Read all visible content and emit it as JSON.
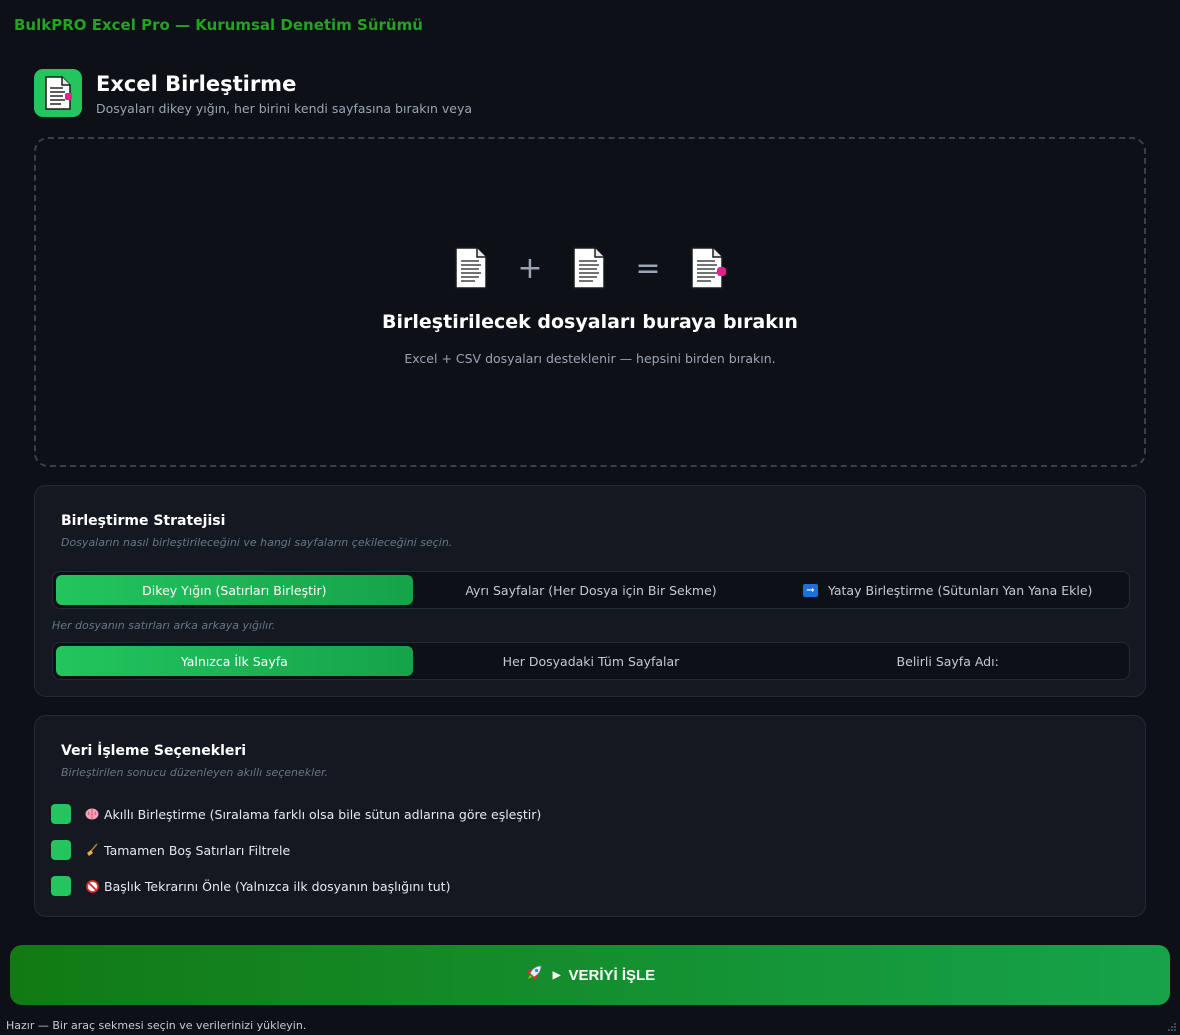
{
  "app": {
    "title": "BulkPRO Excel Pro — Kurumsal Denetim Sürümü"
  },
  "header": {
    "icon": "spreadsheet-merge-icon",
    "title": "Excel Birleştirme",
    "subtitle": "Dosyaları dikey yığın, her birini kendi sayfasına bırakın veya"
  },
  "dropzone": {
    "op_plus": "+",
    "op_equals": "=",
    "title": "Birleştirilecek dosyaları buraya bırakın",
    "subtitle": "Excel + CSV dosyaları desteklenir — hepsini birden bırakın."
  },
  "strategy": {
    "title": "Birleştirme Stratejisi",
    "subtitle": "Dosyaların nasıl birleştirileceğini ve hangi sayfaların çekileceğini seçin.",
    "modes": [
      {
        "label": "Dikey Yığın (Satırları Birleştir)",
        "active": true
      },
      {
        "label": "Ayrı Sayfalar (Her Dosya için Bir Sekme)",
        "active": false
      },
      {
        "label": "Yatay Birleştirme (Sütunları Yan Yana Ekle)",
        "active": false,
        "icon": "right-arrow-icon"
      }
    ],
    "mode_hint": "Her dosyanın satırları arka arkaya yığılır.",
    "sheets": [
      {
        "label": "Yalnızca İlk Sayfa",
        "active": true
      },
      {
        "label": "Her Dosyadaki Tüm Sayfalar",
        "active": false
      },
      {
        "label": "Belirli Sayfa Adı:",
        "active": false
      }
    ]
  },
  "processing": {
    "title": "Veri İşleme Seçenekleri",
    "subtitle": "Birleştirilen sonucu düzenleyen akıllı seçenekler.",
    "options": [
      {
        "label": "Akıllı Birleştirme (Sıralama farklı olsa bile sütun adlarına göre eşleştir)",
        "icon": "brain-icon",
        "checked": true
      },
      {
        "label": "Tamamen Boş Satırları Filtrele",
        "icon": "broom-icon",
        "checked": true
      },
      {
        "label": "Başlık Tekrarını Önle (Yalnızca ilk dosyanın başlığını tut)",
        "icon": "no-entry-icon",
        "checked": true
      }
    ]
  },
  "process_button": {
    "label": "VERİYİ İŞLE",
    "icon": "rocket-icon"
  },
  "status": {
    "text": "Hazır — Bir araç sekmesi seçin ve verilerinizi yükleyin."
  },
  "colors": {
    "accent": "#22c55e",
    "title_green": "#22a321",
    "background": "#0d1016",
    "card": "#141821"
  }
}
